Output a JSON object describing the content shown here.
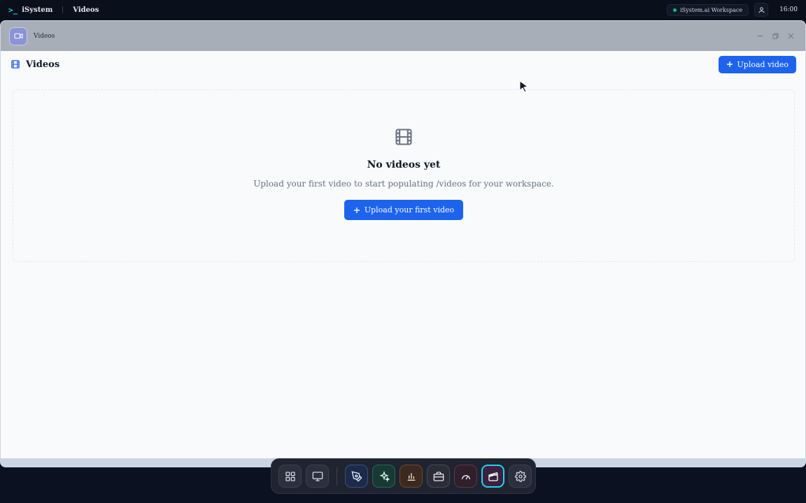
{
  "topbar": {
    "brand_icon": ">_",
    "brand_name": "iSystem",
    "breadcrumb": "Videos",
    "workspace": "iSystem.ai Workspace",
    "time": "16:00"
  },
  "window": {
    "title": "Videos",
    "app_icon": "video-camera-icon"
  },
  "header": {
    "title": "Videos",
    "icon": "film-icon",
    "upload_label": "Upload video"
  },
  "empty_state": {
    "icon": "film-icon",
    "title": "No videos yet",
    "subtitle": "Upload your first video to start populating /videos for your workspace.",
    "cta_label": "Upload your first video"
  },
  "dock": {
    "items": [
      {
        "icon": "grid-icon"
      },
      {
        "icon": "monitor-icon"
      },
      {
        "icon": "pen-icon"
      },
      {
        "icon": "sparkles-icon"
      },
      {
        "icon": "bar-chart-icon"
      },
      {
        "icon": "briefcase-icon"
      },
      {
        "icon": "gauge-icon"
      },
      {
        "icon": "clapperboard-icon",
        "active": true
      },
      {
        "icon": "gear-icon"
      }
    ]
  },
  "colors": {
    "accent": "#1d63ed",
    "active_ring": "#22d3ee"
  }
}
